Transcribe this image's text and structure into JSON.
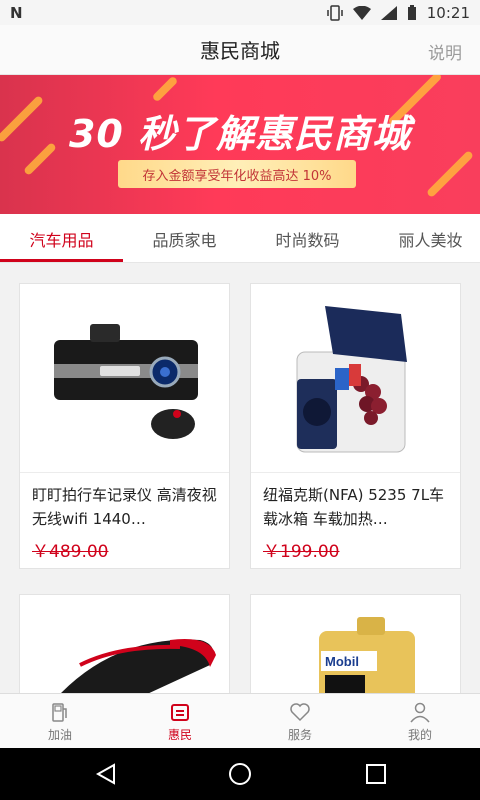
{
  "status": {
    "carrier_icon": "n-icon",
    "time": "10:21"
  },
  "header": {
    "title": "惠民商城",
    "help": "说明"
  },
  "banner": {
    "headline": "30 秒了解惠民商城",
    "ribbon": "存入金额享受年化收益高达 10%"
  },
  "tabs": [
    {
      "label": "汽车用品",
      "active": true
    },
    {
      "label": "品质家电",
      "active": false
    },
    {
      "label": "时尚数码",
      "active": false
    },
    {
      "label": "丽人美妆",
      "active": false
    }
  ],
  "products": [
    {
      "name": "盯盯拍行车记录仪 高清夜视无线wifi 1440…",
      "price": "￥489.00",
      "image": "dashcam-image"
    },
    {
      "name": "纽福克斯(NFA) 5235 7L车载冰箱 车载加热…",
      "price": "￥199.00",
      "image": "car-cooler-image"
    },
    {
      "name": "",
      "price": "",
      "image": "car-device-image"
    },
    {
      "name": "",
      "price": "",
      "image": "mobil-oil-image"
    }
  ],
  "bottom_tabs": [
    {
      "label": "加油",
      "icon": "fuel-icon",
      "active": false
    },
    {
      "label": "惠民",
      "icon": "wallet-icon",
      "active": true
    },
    {
      "label": "服务",
      "icon": "heart-icon",
      "active": false
    },
    {
      "label": "我的",
      "icon": "user-icon",
      "active": false
    }
  ],
  "colors": {
    "accent": "#d0021b",
    "banner": "#ff3a58"
  }
}
